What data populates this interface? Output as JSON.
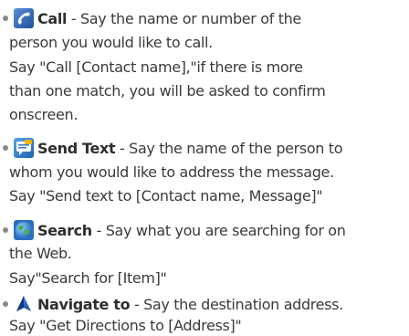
{
  "items": [
    {
      "icon": "phone-handset-icon",
      "title": "Call",
      "description": " - Say the name or number of the",
      "lines": [
        "person you would like to call.",
        "Say \"Call [Contact name],\"if there is more",
        "than one match, you will be asked to confirm",
        "onscreen."
      ]
    },
    {
      "icon": "message-icon",
      "title": "Send Text",
      "description": " - Say the name of the person to",
      "lines": [
        "whom you would like to address the message.",
        "Say \"Send text to [Contact name, Message]\""
      ]
    },
    {
      "icon": "globe-icon",
      "title": "Search",
      "description": " - Say what you are searching for on",
      "lines": [
        "the Web.",
        "Say\"Search for [Item]\""
      ]
    },
    {
      "icon": "navigation-arrow-icon",
      "title": "Navigate to",
      "description": " - Say the destination address.",
      "lines": [
        "Say \"Get Directions to [Address]\""
      ]
    }
  ]
}
